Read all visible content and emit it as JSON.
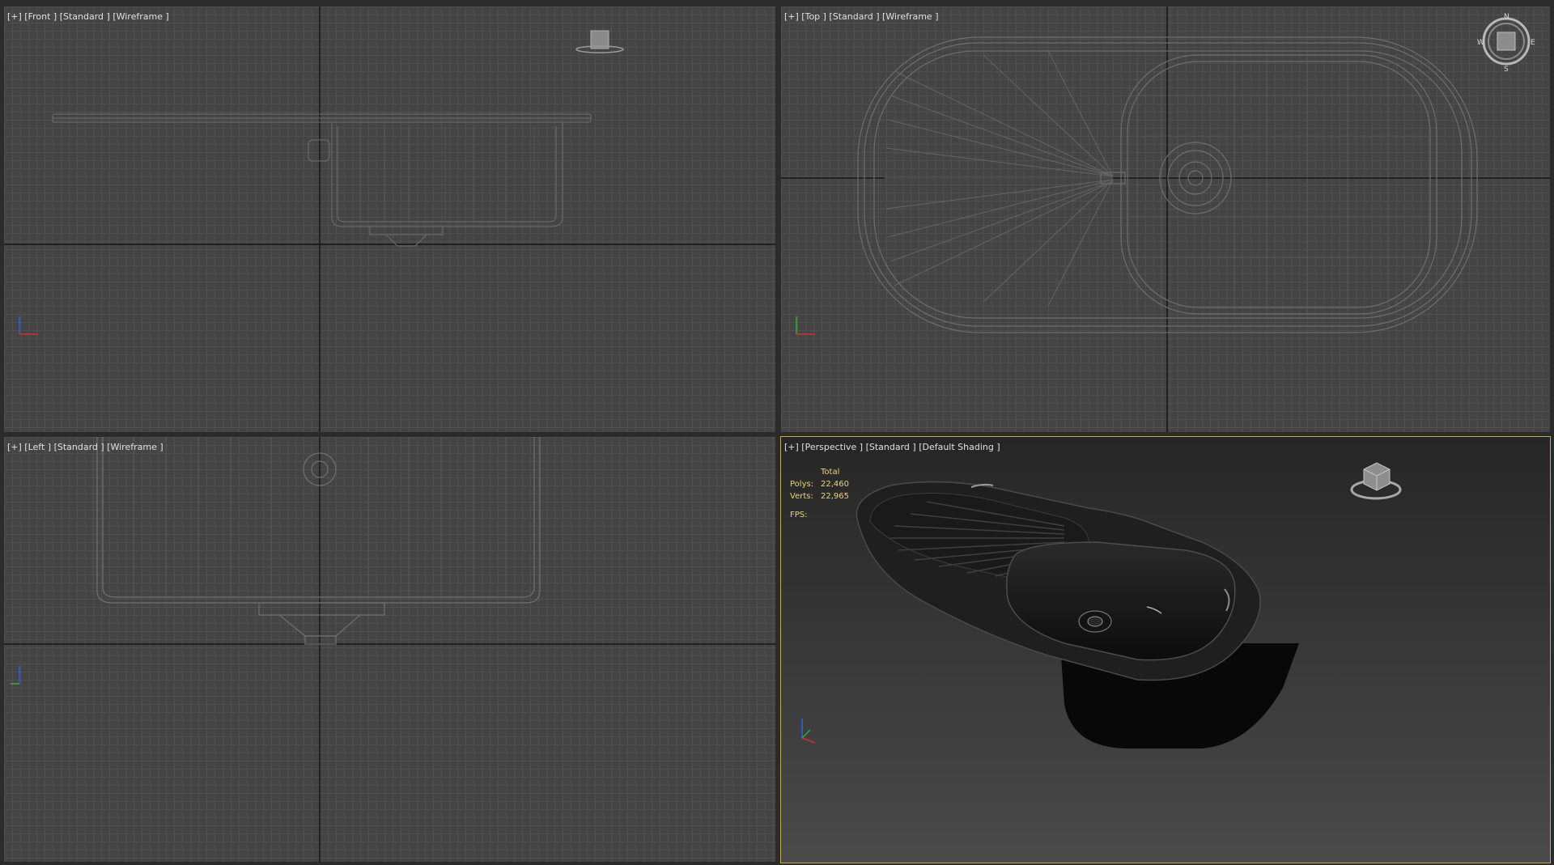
{
  "viewports": {
    "front": {
      "label": "[+] [Front ] [Standard ] [Wireframe ]"
    },
    "top": {
      "label": "[+] [Top ] [Standard ] [Wireframe ]"
    },
    "left": {
      "label": "[+] [Left ] [Standard ] [Wireframe ]"
    },
    "perspective": {
      "label": "[+] [Perspective ] [Standard ] [Default Shading ]"
    }
  },
  "stats": {
    "header": "Total",
    "polys_label": "Polys:",
    "polys_value": "22,460",
    "verts_label": "Verts:",
    "verts_value": "22,965",
    "fps_label": "FPS:"
  },
  "compass": {
    "n": "N",
    "s": "S",
    "e": "E",
    "w": "W"
  },
  "colors": {
    "active_border": "#c8a84a",
    "stats_text": "#e8d47a",
    "axis_x": "#d03030",
    "axis_y": "#30b030",
    "axis_z": "#3060e0"
  }
}
